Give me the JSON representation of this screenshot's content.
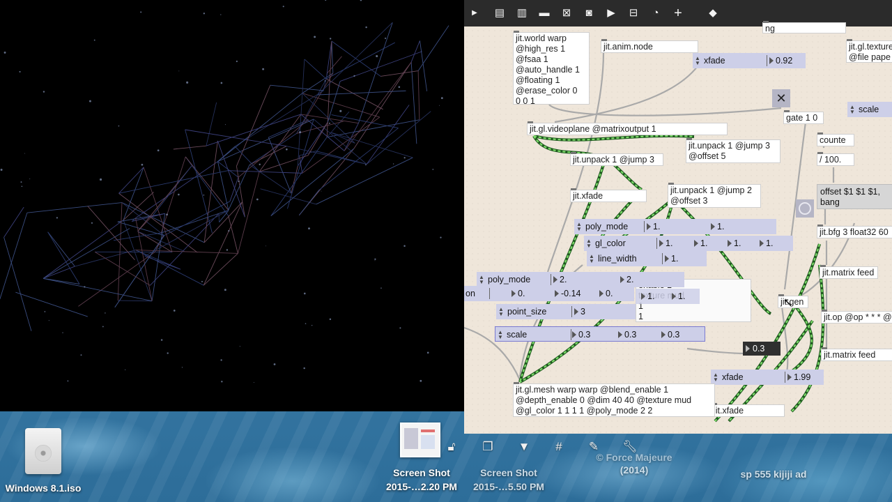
{
  "render_window": {
    "description_icon": "jitter-render-icon"
  },
  "toolbar": {
    "items": [
      "chevron-down-icon",
      "patcher-window-icon",
      "message-icon",
      "comment-icon",
      "button-icon",
      "toggle-icon",
      "number-icon",
      "inlet-icon",
      "slider-icon",
      "dial-icon",
      "add-object-icon",
      "paint-bucket-icon"
    ]
  },
  "patch": {
    "world": "jit.world warp\n@high_res 1\n@fsaa 1\n@auto_handle 1\n@floating 1\n@erase_color 0\n0 0 1",
    "anim_node": "jit.anim.node",
    "top_ng": "ng",
    "texture_top": "jit.gl.texture\n@file pape",
    "xfade_top": {
      "label": "xfade",
      "value": "0.92"
    },
    "videoplane": "jit.gl.videoplane @matrixoutput 1",
    "gate": "gate 1 0",
    "scale_right": "scale",
    "counter": "counte",
    "div100": "/ 100.",
    "unpack_a": "jit.unpack 1 @jump 3\n@offset 5",
    "unpack_b": "jit.unpack 1 @jump 3",
    "unpack_c": "jit.unpack 1 @jump 2\n@offset 3",
    "xfade_obj": "jit.xfade",
    "offset_msg": "offset $1 $1 $1,\nbang",
    "bfg": "jit.bfg 3 float32 60",
    "matrix_feed_a": "jit.matrix feed",
    "jit_op": "jit.op @op * * * @",
    "matrix_feed_b": "jit.matrix feed",
    "jit_gen": "jit.gen",
    "poly_mode_a": {
      "label": "poly_mode",
      "v1": "1.",
      "v2": "1."
    },
    "gl_color": {
      "label": "gl_color",
      "v1": "1.",
      "v2": "1.",
      "v3": "1.",
      "v4": "1."
    },
    "line_width": {
      "label": "line_width",
      "v1": "1."
    },
    "poly_mode_b": {
      "label": "poly_mode",
      "v1": "2.",
      "v2": "2."
    },
    "row_b": {
      "v1": "0.",
      "v2": "-0.14",
      "v3": "0."
    },
    "on_label": "on",
    "hidden_obj": "enable 1\ntexture mud\n1\n1",
    "row_c": {
      "v1": "1.",
      "v2": "1."
    },
    "point_size": {
      "label": "point_size",
      "v1": "3"
    },
    "scale_attr": {
      "label": "scale",
      "v1": "0.3",
      "v2": "0.3",
      "v3": "0.3"
    },
    "float_box": "0.3",
    "xfade_bottom": {
      "label": "xfade",
      "value": "1.99"
    },
    "xfade_obj_bottom": "jit.xfade",
    "mesh": "jit.gl.mesh warp warp @blend_enable 1\n@depth_enable 0 @dim 40 40 @texture mud\n@gl_color 1 1 1 1 @poly_mode 2 2"
  },
  "presentation_bar": [
    "lock-icon",
    "new-view-icon",
    "presentation-icon",
    "grid-icon",
    "snap-icon",
    "wrench-icon"
  ],
  "desktop": {
    "icons": [
      {
        "label": "Windows 8.1.iso"
      },
      {
        "label1": "Screen Shot",
        "label2": "2015-…2.20 PM"
      },
      {
        "label1": "Screen Shot",
        "label2": "2015-…5.50 PM"
      }
    ],
    "faded1": "© Force Majeure",
    "faded2": "(2014)",
    "faded3": "sp 555 kijiji ad"
  }
}
